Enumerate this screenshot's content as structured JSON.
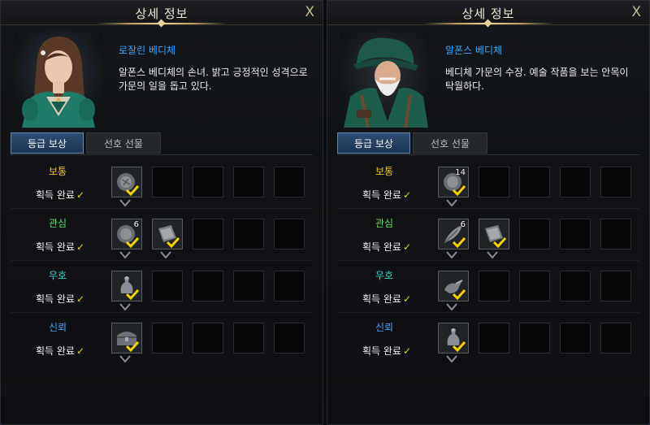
{
  "colors": {
    "name_blue": "#35a6ff",
    "tier_yellow": "#f0c417",
    "tier_green": "#5ce05c",
    "tier_teal": "#33d6c8",
    "tier_blue": "#4aa6ff",
    "check_yellow": "#f3d300"
  },
  "panels": [
    {
      "title": "상세 정보",
      "close_label": "X",
      "npc_name": "로잘린 베디체",
      "npc_desc": "알폰스 베디체의 손녀. 밝고 긍정적인 성격으로 가문의 일을 돕고 있다.",
      "tabs": [
        {
          "label": "등급 보상"
        },
        {
          "label": "선호 선물"
        }
      ],
      "tiers": [
        {
          "name": "보통",
          "status": "획득 완료",
          "rewards": [
            {
              "icon": "medal-icon",
              "count": ""
            }
          ]
        },
        {
          "name": "관심",
          "status": "획득 완료",
          "rewards": [
            {
              "icon": "medal-icon",
              "count": "6"
            },
            {
              "icon": "book-icon",
              "count": ""
            }
          ]
        },
        {
          "name": "우호",
          "status": "획득 완료",
          "rewards": [
            {
              "icon": "vase-icon",
              "count": ""
            }
          ]
        },
        {
          "name": "신뢰",
          "status": "획득 완료",
          "rewards": [
            {
              "icon": "chest-icon",
              "count": ""
            }
          ]
        }
      ]
    },
    {
      "title": "상세 정보",
      "close_label": "X",
      "npc_name": "알폰스 베디체",
      "npc_desc": "베디체 가문의 수장. 예술 작품을 보는 안목이 탁월하다.",
      "tabs": [
        {
          "label": "등급 보상"
        },
        {
          "label": "선호 선물"
        }
      ],
      "tiers": [
        {
          "name": "보통",
          "status": "획득 완료",
          "rewards": [
            {
              "icon": "medal-icon",
              "count": "14"
            }
          ]
        },
        {
          "name": "관심",
          "status": "획득 완료",
          "rewards": [
            {
              "icon": "feather-icon",
              "count": "6"
            },
            {
              "icon": "book-icon",
              "count": ""
            }
          ]
        },
        {
          "name": "우호",
          "status": "획득 완료",
          "rewards": [
            {
              "icon": "lamp-icon",
              "count": ""
            }
          ]
        },
        {
          "name": "신뢰",
          "status": "획득 완료",
          "rewards": [
            {
              "icon": "vase-icon",
              "count": ""
            }
          ]
        }
      ]
    }
  ]
}
